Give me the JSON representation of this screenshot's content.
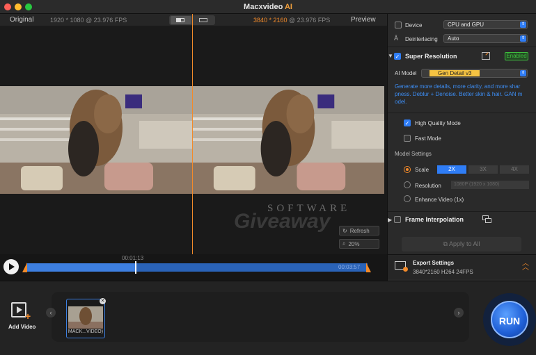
{
  "app": {
    "title_main": "Macxvideo",
    "title_ai": " AI"
  },
  "preview": {
    "original_label": "Original",
    "original_res": "1920 * 1080",
    "original_fps": " @ 23.976 FPS",
    "preview_res": "3840 * 2160",
    "preview_fps": " @ 23.976 FPS",
    "preview_label": "Preview",
    "refresh_label": "Refresh",
    "zoom_label": "20%",
    "watermark_top": "SOFTWARE",
    "watermark_bottom": "Giveaway"
  },
  "timeline": {
    "current_time": "00:01:13",
    "end_time": "00:03:57",
    "progress": 0.32
  },
  "panel": {
    "device_label": "Device",
    "device_value": "CPU and GPU",
    "deinterlacing_label": "Deinterlacing",
    "deinterlacing_value": "Auto",
    "super_res_label": "Super Resolution",
    "super_res_status": "Enabled",
    "ai_model_label": "AI Model",
    "ai_model_value": "Gen Detail v3",
    "desc_line1": "Generate more details, more clarity, and more shar",
    "desc_line2": "pness. Deblur + Denoise. Better skin & hair. GAN m",
    "desc_line3": "odel.",
    "hq_mode_label": "High Quality Mode",
    "fast_mode_label": "Fast Mode",
    "model_settings_label": "Model Settings",
    "scale_label": "Scale",
    "scale_options": [
      "2X",
      "3X",
      "4X"
    ],
    "resolution_label": "Resolution",
    "resolution_value": "1080P (1920 x 1080)",
    "enhance_label": "Enhance Video (1x)",
    "frame_interp_label": "Frame Interpolation",
    "apply_all_label": "Apply to All",
    "export_title": "Export Settings",
    "export_value": "3840*2160 H264 24FPS"
  },
  "media": {
    "add_video_label": "Add Video",
    "clip_name": "MACK...VIDEO)"
  },
  "run_label": "RUN",
  "colors": {
    "accent_blue": "#2f7df6",
    "accent_orange": "#f28a2a",
    "enabled_green": "#3fbf3f"
  }
}
